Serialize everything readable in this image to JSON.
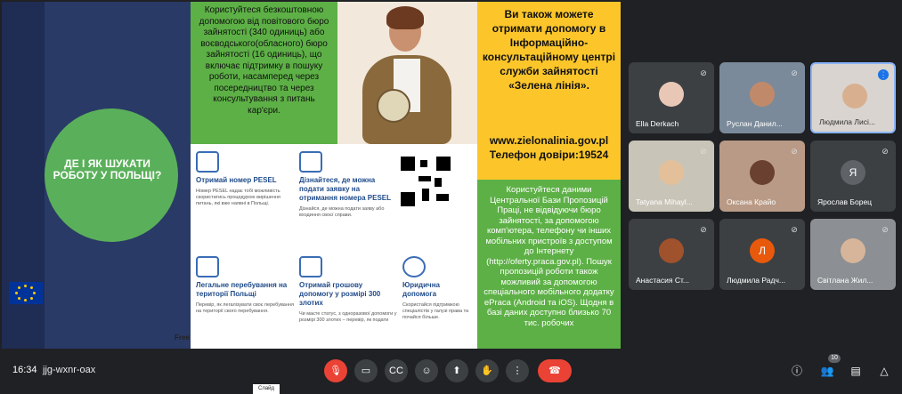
{
  "slide": {
    "left_title": "ДЕ І ЯК ШУКАТИ РОБОТУ У ПОЛЬЩІ?",
    "green_text": "Користуйтеся безкоштовною допомогою від повітового бюро зайнятості (340 одиниць) або воєводського(обласного) бюро зайнятості (16 одиниць), що включає підтримку в пошуку роботи, насамперед через посередництво та через консультування з питань кар'єри.",
    "yellow_text": "Ви також можете отримати допомогу в Інформаційно-консультаційному центрі служби зайнятості «Зелена лінія».",
    "yellow_contact_1": "www.zielonalinia.gov.pl",
    "yellow_contact_2": "Телефон довіри:19524",
    "green2_text": "Користуйтеся даними Центральної Бази Пропозицій Праці, не відвідуючи бюро зайнятості, за допомогою комп'ютера, телефону чи інших мобільних пристроїв з доступом до Інтернету (http://oferty.praca.gov.pl). Пошук пропозицій роботи також можливий за допомогою спеціального мобільного додатку ePraca (Android та iOS). Щодня в базі даних доступно близько 70 тис. робочих",
    "free_label": "Free",
    "cards": [
      {
        "title": "Отримай номер PESEL",
        "desc": "Номер PESEL надає тобі можливість скористатись процедурою вирішення питань, які вже наявні в Польщі."
      },
      {
        "title": "Дізнайтеся, де можна подати заявку на отримання номера PESEL",
        "desc": "Дізнайся, де можна подати заяву або входиння своєї справи."
      },
      {
        "title": "Легальне перебування на території Польщі",
        "desc": "Перевір, як легалізувати своє перебування на території свого перебування."
      },
      {
        "title": "Отримай грошову допомогу у розмірі 300 злотих",
        "desc": "Чи маєте статус, з одноразової допомоги у розмірі 300 злотих – перевір, як подати"
      },
      {
        "title": "Юридична допомога",
        "desc": "Скористайся підтримкою спеціалістів у галузі права та почайся більше."
      }
    ]
  },
  "participants": [
    {
      "name": "Ella Derkach",
      "avatar": ""
    },
    {
      "name": "Руслан Данил...",
      "avatar": ""
    },
    {
      "name": "Людмила Лисі...",
      "avatar": ""
    },
    {
      "name": "Tatyana Mihayl...",
      "avatar": ""
    },
    {
      "name": "Оксана Крайо",
      "avatar": ""
    },
    {
      "name": "Ярослав Борец",
      "avatar": "Я"
    },
    {
      "name": "Анастасия Ст...",
      "avatar": ""
    },
    {
      "name": "Людмила Радч...",
      "avatar": "Л"
    },
    {
      "name": "Світлана Жил...",
      "avatar": ""
    }
  ],
  "bottom_bar": {
    "time": "16:34",
    "meeting_code": "jjg-wxnr-oax",
    "participant_count": "10",
    "tooltip": "Слайд"
  },
  "colors": {
    "end_call": "#ea4335",
    "slide_green": "#5db046",
    "slide_yellow": "#fcc62a",
    "slide_navy": "#2a3a67"
  }
}
